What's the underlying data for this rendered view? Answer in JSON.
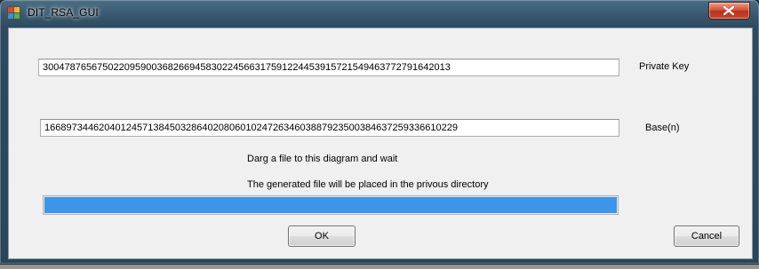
{
  "window": {
    "title": "DIT_RSA_GUI",
    "icon": "app-icon",
    "close_icon": "close-icon"
  },
  "fields": {
    "private_key_value": "3004787656750220959003682669458302245663175912244539157215494637727916420​13",
    "private_key_label": "Private Key",
    "base_value": "16689734462040124571384503286402080601024726346038879235003846372593366102​29",
    "base_label": "Base(n)"
  },
  "messages": {
    "drag_hint": "Darg a file to this diagram and wait",
    "output_hint": "The generated file will be placed in the privous directory"
  },
  "progress": {
    "fraction": 1.0,
    "color": "#3c95e8"
  },
  "buttons": {
    "ok_label": "OK",
    "cancel_label": "Cancel"
  }
}
